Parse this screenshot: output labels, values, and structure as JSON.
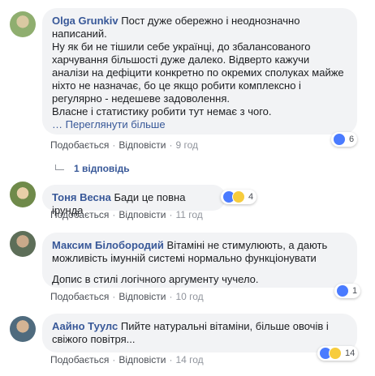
{
  "comments": [
    {
      "name": "Olga Grunkiv",
      "paragraphs": [
        "Пост дуже обережно і неоднозначно написаний.",
        "Ну як би не тішили себе українці, до збалансованого харчування більшості дуже далеко. Відверто кажучи аналізи на дефіцити конкретно по окремих сполуках майже ніхто не назначає, бо це якщо робити комплексно і регулярно - недешеве задоволення.",
        "Власне і статистику робити тут немає з чого."
      ],
      "see_more": "… Переглянути більше",
      "like": "Подобається",
      "reply": "Відповісти",
      "time": "9 год",
      "reactions": "6"
    },
    {
      "name": "Тоня Весна",
      "text": "Бади це повна ірунда",
      "like": "Подобається",
      "reply": "Відповісти",
      "time": "11 год",
      "reactions": "4"
    },
    {
      "name": "Максим Білобородий",
      "text_first": "Вітаміні не стимулюють, а дають можливість імунній системі нормально функціонувати",
      "text_second": "Допис в стилі логічного аргументу чучело.",
      "like": "Подобається",
      "reply": "Відповісти",
      "time": "10 год",
      "reactions": "1"
    },
    {
      "name": "Аайно Туулс",
      "text": "Пийте натуральні вітаміни, більше овочів і свіжого повітря...",
      "like": "Подобається",
      "reply": "Відповісти",
      "time": "14 год",
      "reactions": "14"
    }
  ],
  "replies_link": "1 відповідь",
  "colors": {
    "name": "#385898",
    "bubble": "#f2f3f5",
    "meta": "#90949c",
    "like_icon": "#4a7bff",
    "haha_icon": "#f7cc3d"
  }
}
